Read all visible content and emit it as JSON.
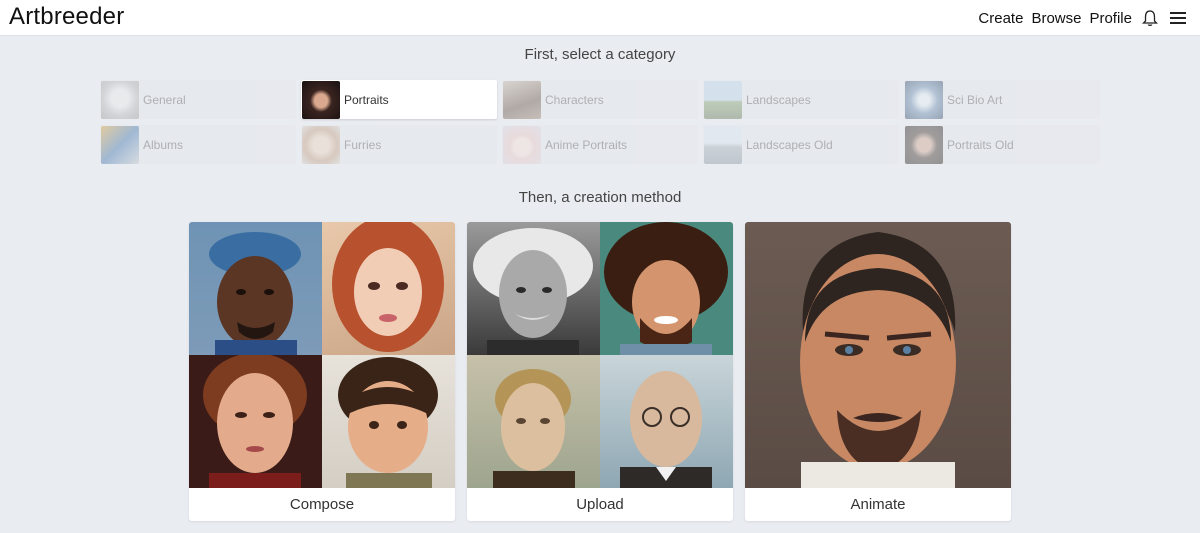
{
  "header": {
    "logo": "Artbreeder",
    "nav": [
      "Create",
      "Browse",
      "Profile"
    ],
    "icons": [
      "bell-icon",
      "menu-icon"
    ]
  },
  "step1": {
    "heading": "First, select a category",
    "categories": [
      {
        "label": "General",
        "selected": false
      },
      {
        "label": "Portraits",
        "selected": true
      },
      {
        "label": "Characters",
        "selected": false
      },
      {
        "label": "Landscapes",
        "selected": false
      },
      {
        "label": "Sci Bio Art",
        "selected": false
      },
      {
        "label": "Albums",
        "selected": false
      },
      {
        "label": "Furries",
        "selected": false
      },
      {
        "label": "Anime Portraits",
        "selected": false
      },
      {
        "label": "Landscapes Old",
        "selected": false
      },
      {
        "label": "Portraits Old",
        "selected": false
      }
    ]
  },
  "step2": {
    "heading": "Then, a creation method",
    "methods": [
      {
        "label": "Compose"
      },
      {
        "label": "Upload"
      },
      {
        "label": "Animate"
      }
    ]
  }
}
